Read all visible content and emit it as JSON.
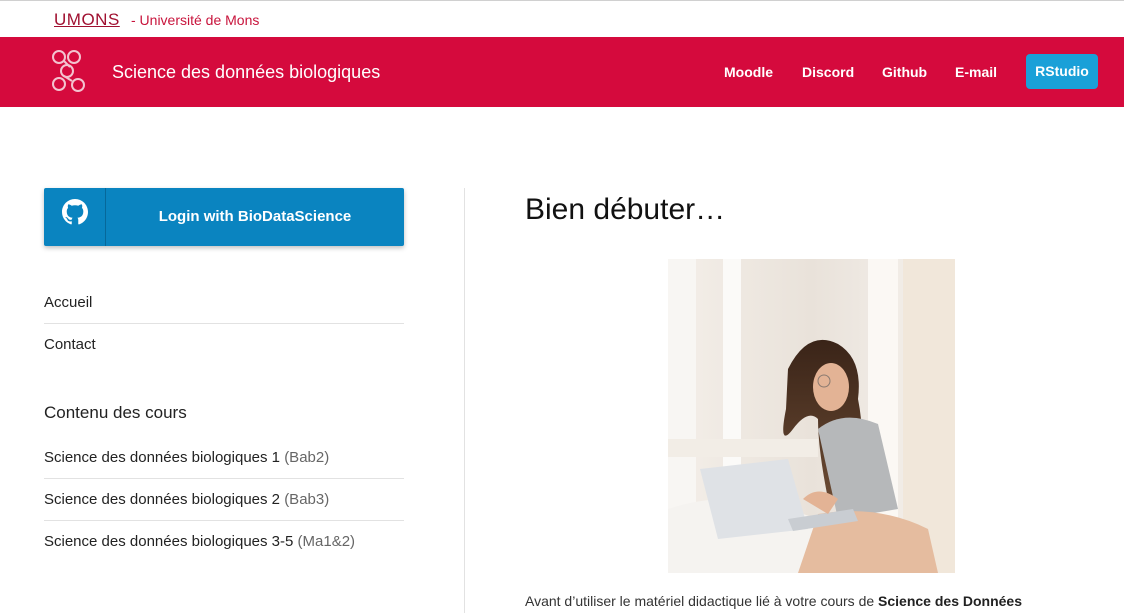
{
  "university": {
    "logo_text": "UMONS",
    "name": "- Université de Mons"
  },
  "navbar": {
    "title": "Science des données biologiques",
    "links": [
      "Moodle",
      "Discord",
      "Github",
      "E-mail"
    ],
    "rstudio_label": "RStudio",
    "bg_color": "#d50a3d",
    "button_color": "#1aa0d8"
  },
  "sidebar": {
    "login_label": "Login with BioDataScience",
    "login_icon": "github-icon",
    "nav_items": [
      "Accueil",
      "Contact"
    ],
    "courses_heading": "Contenu des cours",
    "courses": [
      {
        "name": "Science des données biologiques 1",
        "level": "(Bab2)"
      },
      {
        "name": "Science des données biologiques 2",
        "level": "(Bab3)"
      },
      {
        "name": "Science des données biologiques 3-5",
        "level": "(Ma1&2)"
      }
    ]
  },
  "main": {
    "title": "Bien débuter…",
    "intro_text": "Avant d’utiliser le matériel didactique lié à votre cours de ",
    "intro_bold": "Science des Données"
  }
}
